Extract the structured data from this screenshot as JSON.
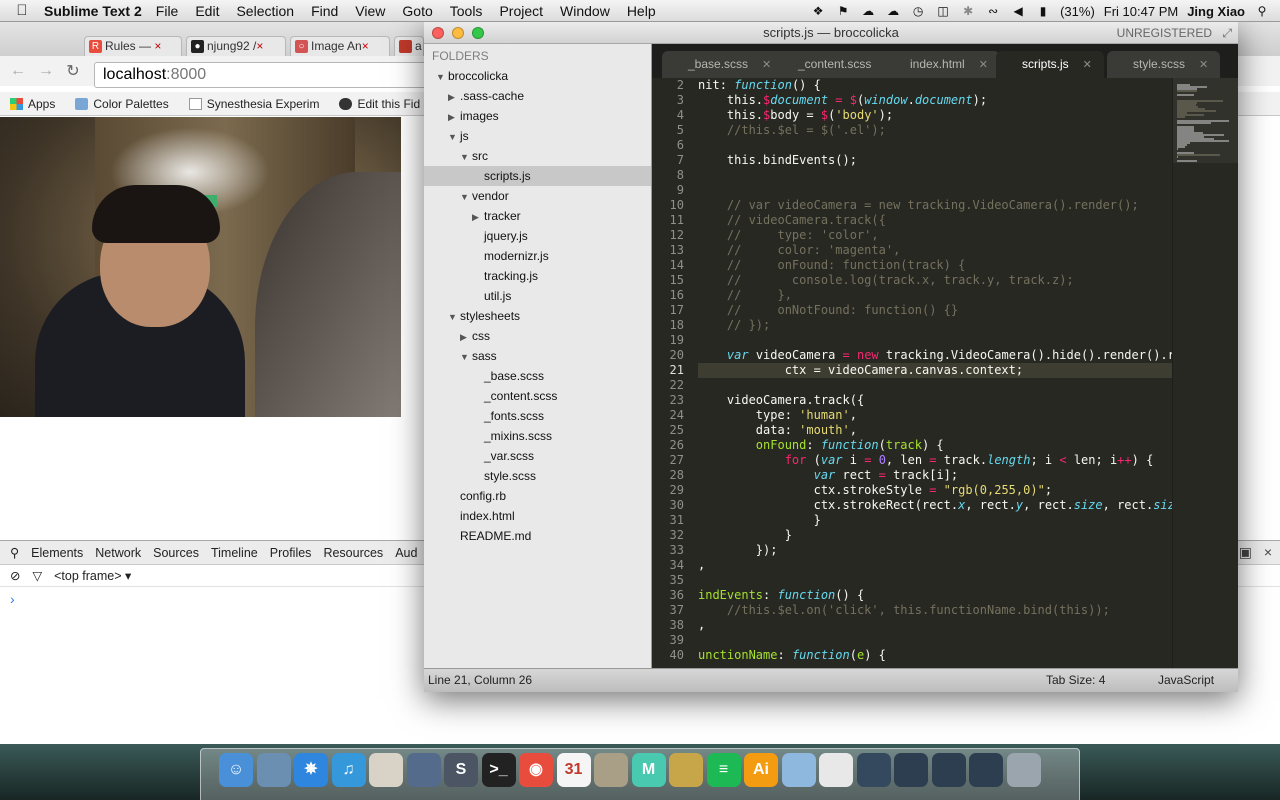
{
  "menubar": {
    "app_name": "Sublime Text 2",
    "items": [
      "File",
      "Edit",
      "Selection",
      "Find",
      "View",
      "Goto",
      "Tools",
      "Project",
      "Window",
      "Help"
    ],
    "battery": "(31%)",
    "clock": "Fri 10:47 PM",
    "user": "Jing Xiao"
  },
  "chrome": {
    "tabs": [
      {
        "label": "Rules — ",
        "trail": "×",
        "color": "#e74c3c"
      },
      {
        "label": "njung92 /",
        "trail": "×",
        "color": "#222222"
      },
      {
        "label": "Image An",
        "trail": "×",
        "color": "#d35454"
      },
      {
        "label": "a",
        "trail": "",
        "color": "#c0392b"
      }
    ],
    "address": {
      "host": "localhost",
      "port": ":8000"
    },
    "bookmarks": [
      "Apps",
      "Color Palettes",
      "Synesthesia Experim",
      "Edit this Fid"
    ],
    "devtools": {
      "panels": [
        "Elements",
        "Network",
        "Sources",
        "Timeline",
        "Profiles",
        "Resources",
        "Aud"
      ],
      "frame": "<top frame> ▾",
      "prompt": "›"
    }
  },
  "sublime": {
    "title": "scripts.js — broccolicka",
    "unregistered": "UNREGISTERED",
    "folders_label": "FOLDERS",
    "tree": [
      {
        "label": "broccolicka",
        "depth": 0,
        "twisty": "▼"
      },
      {
        "label": ".sass-cache",
        "depth": 1,
        "twisty": "▶"
      },
      {
        "label": "images",
        "depth": 1,
        "twisty": "▶"
      },
      {
        "label": "js",
        "depth": 1,
        "twisty": "▼"
      },
      {
        "label": "src",
        "depth": 2,
        "twisty": "▼"
      },
      {
        "label": "scripts.js",
        "depth": 3,
        "twisty": "",
        "selected": true
      },
      {
        "label": "vendor",
        "depth": 2,
        "twisty": "▼"
      },
      {
        "label": "tracker",
        "depth": 3,
        "twisty": "▶"
      },
      {
        "label": "jquery.js",
        "depth": 3,
        "twisty": ""
      },
      {
        "label": "modernizr.js",
        "depth": 3,
        "twisty": ""
      },
      {
        "label": "tracking.js",
        "depth": 3,
        "twisty": ""
      },
      {
        "label": "util.js",
        "depth": 3,
        "twisty": ""
      },
      {
        "label": "stylesheets",
        "depth": 1,
        "twisty": "▼"
      },
      {
        "label": "css",
        "depth": 2,
        "twisty": "▶"
      },
      {
        "label": "sass",
        "depth": 2,
        "twisty": "▼"
      },
      {
        "label": "_base.scss",
        "depth": 3,
        "twisty": ""
      },
      {
        "label": "_content.scss",
        "depth": 3,
        "twisty": ""
      },
      {
        "label": "_fonts.scss",
        "depth": 3,
        "twisty": ""
      },
      {
        "label": "_mixins.scss",
        "depth": 3,
        "twisty": ""
      },
      {
        "label": "_var.scss",
        "depth": 3,
        "twisty": ""
      },
      {
        "label": "style.scss",
        "depth": 3,
        "twisty": ""
      },
      {
        "label": "config.rb",
        "depth": 1,
        "twisty": ""
      },
      {
        "label": "index.html",
        "depth": 1,
        "twisty": ""
      },
      {
        "label": "README.md",
        "depth": 1,
        "twisty": ""
      }
    ],
    "tabs": [
      {
        "label": "_base.scss",
        "active": false
      },
      {
        "label": "_content.scss",
        "active": false
      },
      {
        "label": "index.html",
        "active": false
      },
      {
        "label": "scripts.js",
        "active": true
      },
      {
        "label": "style.scss",
        "active": false
      }
    ],
    "current_line": 21,
    "code": [
      {
        "n": "2",
        "t": [
          [
            "nit",
            ""
          ],
          [
            ": ",
            ""
          ],
          [
            "function",
            "i"
          ],
          [
            "() {",
            ""
          ]
        ]
      },
      {
        "n": "3",
        "t": [
          [
            "    this.",
            ""
          ],
          [
            "$",
            "k"
          ],
          [
            "document",
            "i"
          ],
          [
            " = ",
            "k"
          ],
          [
            "$",
            "k"
          ],
          [
            "(",
            ""
          ],
          [
            "window",
            "i"
          ],
          [
            ".",
            ""
          ],
          [
            "document",
            "i"
          ],
          [
            ");",
            ""
          ]
        ]
      },
      {
        "n": "4",
        "t": [
          [
            "    this.",
            ""
          ],
          [
            "$",
            "k"
          ],
          [
            "body = ",
            ""
          ],
          [
            "$",
            "k"
          ],
          [
            "(",
            ""
          ],
          [
            "'body'",
            "s"
          ],
          [
            ");",
            ""
          ]
        ]
      },
      {
        "n": "5",
        "t": [
          [
            "    //this.$el = $('.el');",
            "c"
          ]
        ]
      },
      {
        "n": "6",
        "t": [
          [
            "",
            ""
          ]
        ]
      },
      {
        "n": "7",
        "t": [
          [
            "    this.bindEvents();",
            ""
          ]
        ]
      },
      {
        "n": "8",
        "t": [
          [
            "",
            ""
          ]
        ]
      },
      {
        "n": "9",
        "t": [
          [
            "",
            ""
          ]
        ]
      },
      {
        "n": "10",
        "t": [
          [
            "    // var videoCamera = new tracking.VideoCamera().render();",
            "c"
          ]
        ]
      },
      {
        "n": "11",
        "t": [
          [
            "    // videoCamera.track({",
            "c"
          ]
        ]
      },
      {
        "n": "12",
        "t": [
          [
            "    //     type: 'color',",
            "c"
          ]
        ]
      },
      {
        "n": "13",
        "t": [
          [
            "    //     color: 'magenta',",
            "c"
          ]
        ]
      },
      {
        "n": "14",
        "t": [
          [
            "    //     onFound: function(track) {",
            "c"
          ]
        ]
      },
      {
        "n": "15",
        "t": [
          [
            "    //       console.log(track.x, track.y, track.z);",
            "c"
          ]
        ]
      },
      {
        "n": "16",
        "t": [
          [
            "    //     },",
            "c"
          ]
        ]
      },
      {
        "n": "17",
        "t": [
          [
            "    //     onNotFound: function() {}",
            "c"
          ]
        ]
      },
      {
        "n": "18",
        "t": [
          [
            "    // });",
            "c"
          ]
        ]
      },
      {
        "n": "19",
        "t": [
          [
            "",
            ""
          ]
        ]
      },
      {
        "n": "20",
        "t": [
          [
            "    ",
            ""
          ],
          [
            "var",
            "i"
          ],
          [
            " videoCamera ",
            ""
          ],
          [
            "=",
            "k"
          ],
          [
            " ",
            ""
          ],
          [
            "new",
            "k"
          ],
          [
            " tracking.VideoCamera().hide().render().rend",
            ""
          ]
        ]
      },
      {
        "n": "21",
        "t": [
          [
            "            ctx = videoCamera.canvas.context;",
            ""
          ]
        ]
      },
      {
        "n": "22",
        "t": [
          [
            "",
            ""
          ]
        ]
      },
      {
        "n": "23",
        "t": [
          [
            "    videoCamera.track({",
            ""
          ]
        ]
      },
      {
        "n": "24",
        "t": [
          [
            "        type: ",
            ""
          ],
          [
            "'human'",
            "s"
          ],
          [
            ",",
            ""
          ]
        ]
      },
      {
        "n": "25",
        "t": [
          [
            "        data: ",
            ""
          ],
          [
            "'mouth'",
            "s"
          ],
          [
            ",",
            ""
          ]
        ]
      },
      {
        "n": "26",
        "t": [
          [
            "        ",
            ""
          ],
          [
            "onFound",
            "f"
          ],
          [
            ": ",
            ""
          ],
          [
            "function",
            "i"
          ],
          [
            "(",
            ""
          ],
          [
            "track",
            "f"
          ],
          [
            ") {",
            ""
          ]
        ]
      },
      {
        "n": "27",
        "t": [
          [
            "            ",
            ""
          ],
          [
            "for",
            "k"
          ],
          [
            " (",
            ""
          ],
          [
            "var",
            "i"
          ],
          [
            " i ",
            ""
          ],
          [
            "=",
            "k"
          ],
          [
            " ",
            ""
          ],
          [
            "0",
            "n"
          ],
          [
            ", len ",
            ""
          ],
          [
            "=",
            "k"
          ],
          [
            " track.",
            ""
          ],
          [
            "length",
            "i"
          ],
          [
            "; i ",
            ""
          ],
          [
            "<",
            "k"
          ],
          [
            " len; i",
            ""
          ],
          [
            "++",
            "k"
          ],
          [
            ") {",
            ""
          ]
        ]
      },
      {
        "n": "28",
        "t": [
          [
            "                ",
            ""
          ],
          [
            "var",
            "i"
          ],
          [
            " rect ",
            ""
          ],
          [
            "=",
            "k"
          ],
          [
            " track[i];",
            ""
          ]
        ]
      },
      {
        "n": "29",
        "t": [
          [
            "                ctx.strokeStyle ",
            ""
          ],
          [
            "=",
            "k"
          ],
          [
            " ",
            ""
          ],
          [
            "\"rgb(0,255,0)\"",
            "s"
          ],
          [
            ";",
            ""
          ]
        ]
      },
      {
        "n": "30",
        "t": [
          [
            "                ctx.strokeRect(rect.",
            ""
          ],
          [
            "x",
            "i"
          ],
          [
            ", rect.",
            ""
          ],
          [
            "y",
            "i"
          ],
          [
            ", rect.",
            ""
          ],
          [
            "size",
            "i"
          ],
          [
            ", rect.",
            ""
          ],
          [
            "size",
            "i"
          ],
          [
            ");",
            ""
          ]
        ]
      },
      {
        "n": "31",
        "t": [
          [
            "                }",
            ""
          ]
        ]
      },
      {
        "n": "32",
        "t": [
          [
            "            }",
            ""
          ]
        ]
      },
      {
        "n": "33",
        "t": [
          [
            "        });",
            ""
          ]
        ]
      },
      {
        "n": "34",
        "t": [
          [
            ",",
            ""
          ]
        ]
      },
      {
        "n": "35",
        "t": [
          [
            "",
            ""
          ]
        ]
      },
      {
        "n": "36",
        "t": [
          [
            "indEvents",
            "f"
          ],
          [
            ": ",
            ""
          ],
          [
            "function",
            "i"
          ],
          [
            "() {",
            ""
          ]
        ]
      },
      {
        "n": "37",
        "t": [
          [
            "    //this.$el.on('click', this.functionName.bind(this));",
            "c"
          ]
        ]
      },
      {
        "n": "38",
        "t": [
          [
            ",",
            ""
          ]
        ]
      },
      {
        "n": "39",
        "t": [
          [
            "",
            ""
          ]
        ]
      },
      {
        "n": "40",
        "t": [
          [
            "unctionName",
            "f"
          ],
          [
            ": ",
            ""
          ],
          [
            "function",
            "i"
          ],
          [
            "(",
            ""
          ],
          [
            "e",
            "f"
          ],
          [
            ") {",
            ""
          ]
        ]
      }
    ],
    "status": {
      "position": "Line 21, Column 26",
      "tab_size": "Tab Size: 4",
      "syntax": "JavaScript"
    }
  },
  "dock": [
    {
      "name": "finder-icon",
      "color": "#4a90d9",
      "glyph": "☺"
    },
    {
      "name": "preview-icon",
      "color": "#6b8fb0",
      "glyph": ""
    },
    {
      "name": "safari-icon",
      "color": "#2e86de",
      "glyph": "✵"
    },
    {
      "name": "itunes-icon",
      "color": "#3498db",
      "glyph": "♫"
    },
    {
      "name": "textedit-icon",
      "color": "#d8d3c6",
      "glyph": ""
    },
    {
      "name": "photos-icon",
      "color": "#556b8c",
      "glyph": ""
    },
    {
      "name": "sublime-dock-icon",
      "color": "#4b5563",
      "glyph": "S"
    },
    {
      "name": "terminal-icon",
      "color": "#222222",
      "glyph": ">_"
    },
    {
      "name": "chrome-icon",
      "color": "#e74c3c",
      "glyph": "◉"
    },
    {
      "name": "calendar-icon",
      "color": "#f5f5f5",
      "glyph": "31"
    },
    {
      "name": "latex-icon",
      "color": "#a89f86",
      "glyph": ""
    },
    {
      "name": "mou-icon",
      "color": "#48c9b0",
      "glyph": "M"
    },
    {
      "name": "transmit-icon",
      "color": "#c7a64a",
      "glyph": ""
    },
    {
      "name": "spotify-icon",
      "color": "#1db954",
      "glyph": "≡"
    },
    {
      "name": "illustrator-icon",
      "color": "#f39c12",
      "glyph": "Ai"
    },
    {
      "name": "downloads-folder-icon",
      "color": "#8fb8de",
      "glyph": ""
    },
    {
      "name": "documents-icon",
      "color": "#e8e8e8",
      "glyph": ""
    },
    {
      "name": "screenshot-icon",
      "color": "#34495e",
      "glyph": ""
    },
    {
      "name": "minimized-window-icon",
      "color": "#2c3e50",
      "glyph": ""
    },
    {
      "name": "minimized-window-icon-2",
      "color": "#2c3e50",
      "glyph": ""
    },
    {
      "name": "minimized-window-icon-3",
      "color": "#2c3e50",
      "glyph": ""
    },
    {
      "name": "trash-icon",
      "color": "#9aa5ad",
      "glyph": ""
    }
  ]
}
